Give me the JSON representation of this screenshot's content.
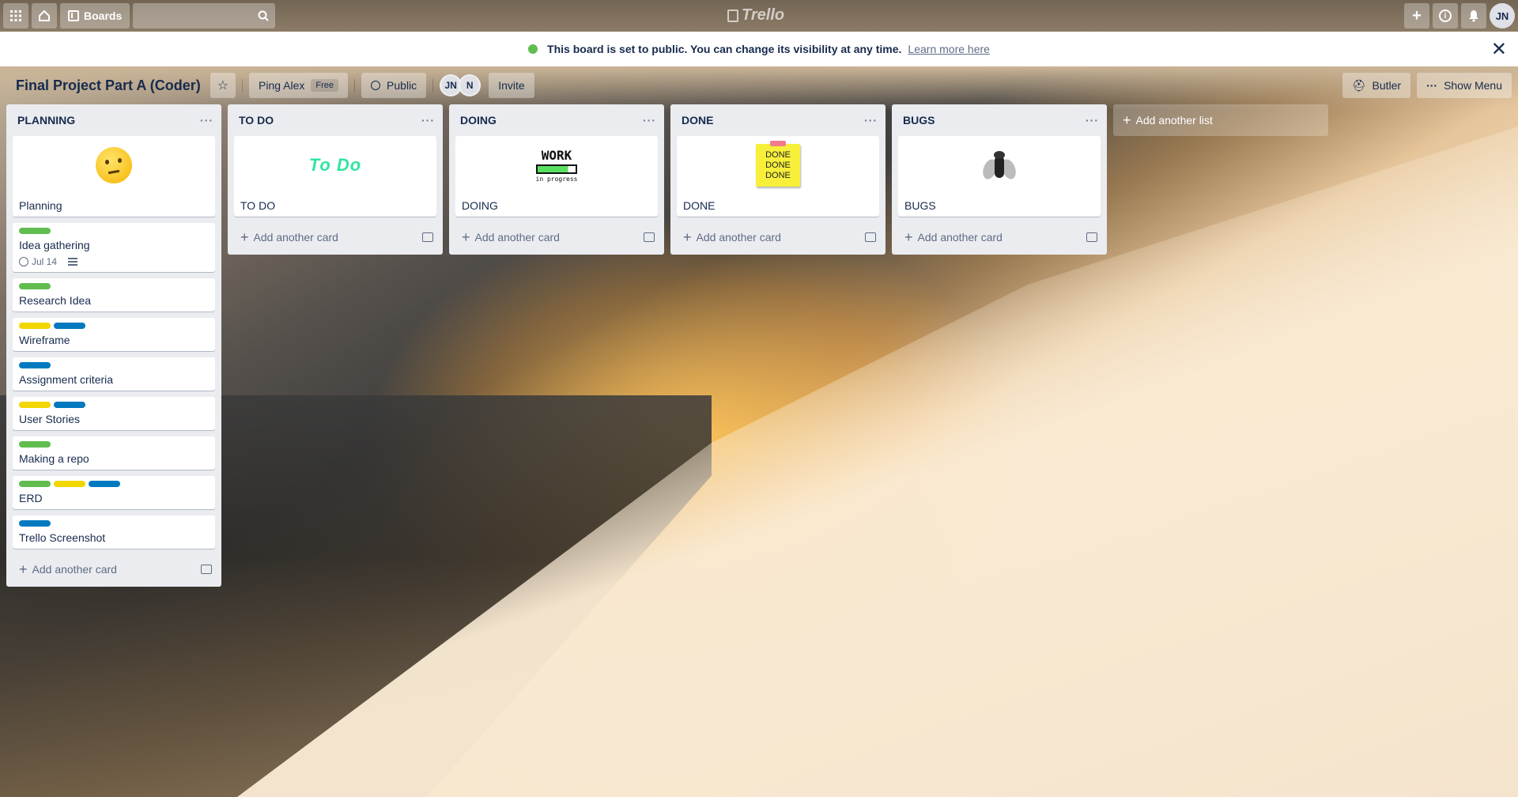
{
  "topbar": {
    "boards_label": "Boards",
    "logo_text": "Trello",
    "user_initials": "JN"
  },
  "banner": {
    "message": "This board is set to public. You can change its visibility at any time.",
    "link": "Learn more here"
  },
  "board": {
    "title": "Final Project Part A (Coder)",
    "team": "Ping Alex",
    "plan": "Free",
    "visibility": "Public",
    "members": [
      "JN",
      "N"
    ],
    "invite": "Invite",
    "butler": "Butler",
    "show_menu": "Show Menu"
  },
  "colors": {
    "green": "#61bd4f",
    "yellow": "#f2d600",
    "blue": "#0079bf"
  },
  "lists": [
    {
      "title": "PLANNING",
      "cards": [
        {
          "title": "Planning",
          "cover": "thinking-face"
        },
        {
          "title": "Idea gathering",
          "labels": [
            "green"
          ],
          "due": "Jul 14",
          "description": true
        },
        {
          "title": "Research Idea",
          "labels": [
            "green"
          ]
        },
        {
          "title": "Wireframe",
          "labels": [
            "yellow",
            "blue"
          ]
        },
        {
          "title": "Assignment criteria",
          "labels": [
            "blue"
          ]
        },
        {
          "title": "User Stories",
          "labels": [
            "yellow",
            "blue"
          ]
        },
        {
          "title": "Making a repo",
          "labels": [
            "green"
          ]
        },
        {
          "title": "ERD",
          "labels": [
            "green",
            "yellow",
            "blue"
          ]
        },
        {
          "title": "Trello Screenshot",
          "labels": [
            "blue"
          ]
        }
      ],
      "add_card": "Add another card"
    },
    {
      "title": "TO DO",
      "cards": [
        {
          "title": "TO DO",
          "cover": "todo-art",
          "cover_text": "To Do"
        }
      ],
      "add_card": "Add another card"
    },
    {
      "title": "DOING",
      "cards": [
        {
          "title": "DOING",
          "cover": "work-art",
          "cover_text": "WORK",
          "cover_sub": "in progress"
        }
      ],
      "add_card": "Add another card"
    },
    {
      "title": "DONE",
      "cards": [
        {
          "title": "DONE",
          "cover": "done-note",
          "cover_lines": [
            "DONE",
            "DONE",
            "DONE"
          ]
        }
      ],
      "add_card": "Add another card"
    },
    {
      "title": "BUGS",
      "cards": [
        {
          "title": "BUGS",
          "cover": "fly"
        }
      ],
      "add_card": "Add another card"
    }
  ],
  "add_list": "Add another list"
}
